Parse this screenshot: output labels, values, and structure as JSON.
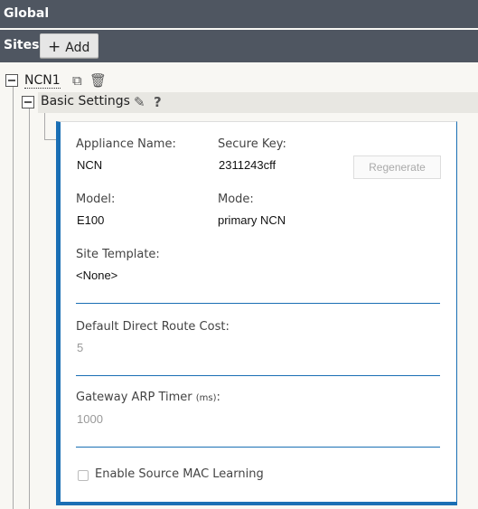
{
  "header": {
    "title": "Global"
  },
  "sites": {
    "label": "Sites",
    "add_label": "Add",
    "add_icon": "plus-icon"
  },
  "tree": {
    "site": "NCN1",
    "section": "Basic Settings",
    "help": "?"
  },
  "form": {
    "appliance_name_label": "Appliance Name:",
    "appliance_name": "NCN",
    "secure_key_label": "Secure Key:",
    "secure_key": "2311243cff",
    "regenerate": "Regenerate",
    "model_label": "Model:",
    "model": "E100",
    "mode_label": "Mode:",
    "mode": "primary NCN",
    "site_template_label": "Site Template:",
    "site_template": "<None>",
    "route_cost_label": "Default Direct Route Cost:",
    "route_cost": "5",
    "arp_label": "Gateway ARP Timer",
    "arp_unit": "(ms)",
    "arp_colon": ":",
    "arp_value": "1000",
    "mac_label": "Enable Source MAC Learning",
    "mac_checked": false
  },
  "colors": {
    "header": "#4f5661",
    "accent": "#1a6fb4"
  }
}
